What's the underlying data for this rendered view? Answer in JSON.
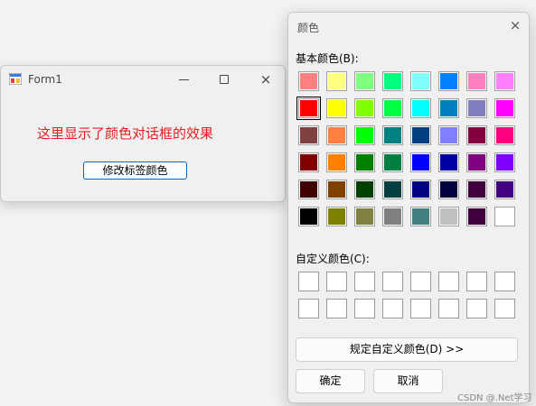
{
  "form1": {
    "title": "Form1",
    "label_text": "这里显示了颜色对话框的效果",
    "label_color": "#e81e1e",
    "button_label": "修改标签颜色",
    "caption_buttons": {
      "minimize": "minimize-icon",
      "maximize": "maximize-icon",
      "close": "×"
    }
  },
  "dialog": {
    "title": "颜色",
    "close": "×",
    "basic_label": "基本颜色(B):",
    "custom_label": "自定义颜色(C):",
    "define_custom_button": "规定自定义颜色(D) >>",
    "ok_button": "确定",
    "cancel_button": "取消",
    "selected_basic_index": 8,
    "basic_colors": [
      "#ff8080",
      "#ffff80",
      "#80ff80",
      "#00ff80",
      "#80ffff",
      "#0080ff",
      "#ff80c0",
      "#ff80ff",
      "#ff0000",
      "#ffff00",
      "#80ff00",
      "#00ff40",
      "#00ffff",
      "#0080c0",
      "#8080c0",
      "#ff00ff",
      "#804040",
      "#ff8040",
      "#00ff00",
      "#008080",
      "#004080",
      "#8080ff",
      "#800040",
      "#ff0080",
      "#800000",
      "#ff8000",
      "#008000",
      "#008040",
      "#0000ff",
      "#0000a0",
      "#800080",
      "#8000ff",
      "#400000",
      "#804000",
      "#004000",
      "#004040",
      "#000080",
      "#000040",
      "#400040",
      "#400080",
      "#000000",
      "#808000",
      "#808040",
      "#808080",
      "#408080",
      "#c0c0c0",
      "#400040",
      "#ffffff"
    ],
    "custom_colors": [
      "#ffffff",
      "#ffffff",
      "#ffffff",
      "#ffffff",
      "#ffffff",
      "#ffffff",
      "#ffffff",
      "#ffffff",
      "#ffffff",
      "#ffffff",
      "#ffffff",
      "#ffffff",
      "#ffffff",
      "#ffffff",
      "#ffffff",
      "#ffffff"
    ]
  },
  "watermark": "CSDN @.Net学习"
}
